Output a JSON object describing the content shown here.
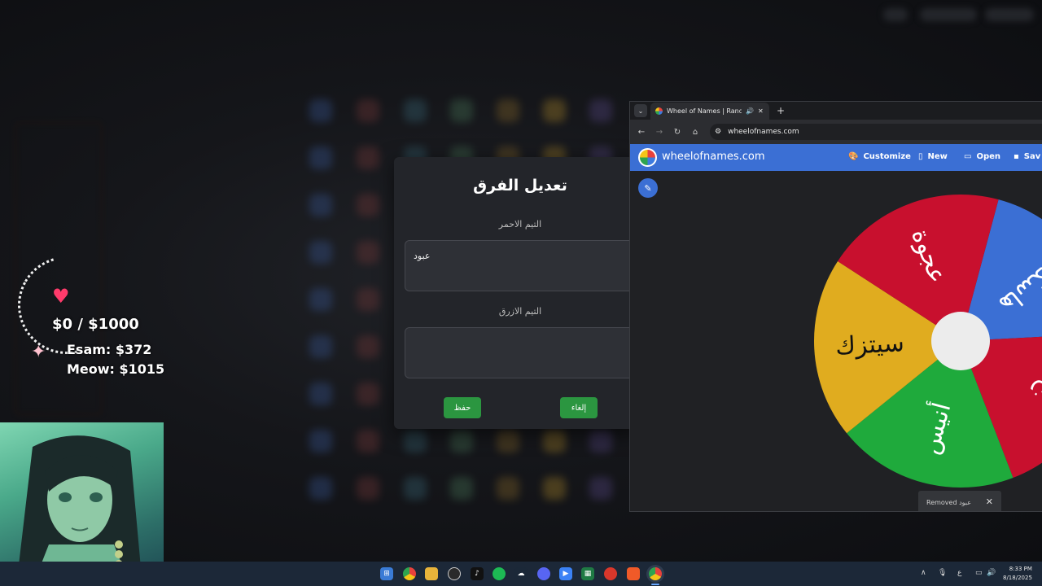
{
  "overlay": {
    "goal_text": "$0 / $1000",
    "donors": [
      {
        "text": "Esam: $372"
      },
      {
        "text": "Meow: $1015"
      }
    ],
    "icons": [
      "heart-icon",
      "sparkle-icon"
    ]
  },
  "dialog": {
    "title": "تعديل الفرق",
    "red_team_label": "التيم الاحمر",
    "red_team_value": "عبود",
    "blue_team_label": "التيم الازرق",
    "blue_team_value": "",
    "save_label": "حفظ",
    "cancel_label": "إلغاء"
  },
  "browser": {
    "tab_title": "Wheel of Names | Random",
    "url": "wheelofnames.com",
    "site_name": "wheelofnames.com",
    "menu": {
      "customize": "Customize",
      "new": "New",
      "open": "Open",
      "save": "Sav"
    },
    "wheel_entries": [
      {
        "label": "هاسكي",
        "color": "#3b6fd4"
      },
      {
        "label": "ن",
        "color": "#c8102e"
      },
      {
        "label": "أنيس",
        "color": "#1faa3c"
      },
      {
        "label": "سيتزك",
        "color": "#e0ac1f"
      },
      {
        "label": "عجوة",
        "color": "#c8102e"
      }
    ],
    "toast": {
      "text": "Removed عبود",
      "close": "✕"
    }
  },
  "taskbar": {
    "time": "8:33 PM",
    "date": "8/18/2025",
    "lang": "ع",
    "apps": [
      "windows-start",
      "chrome",
      "file-explorer",
      "obs",
      "tiktok",
      "spotify",
      "steam",
      "discord",
      "wave",
      "excel",
      "app-red",
      "brave",
      "chrome-active"
    ]
  },
  "colors": {
    "accent_blue": "#3b6fd4",
    "button_green": "#2b9640",
    "dialog_bg": "#23252a"
  }
}
